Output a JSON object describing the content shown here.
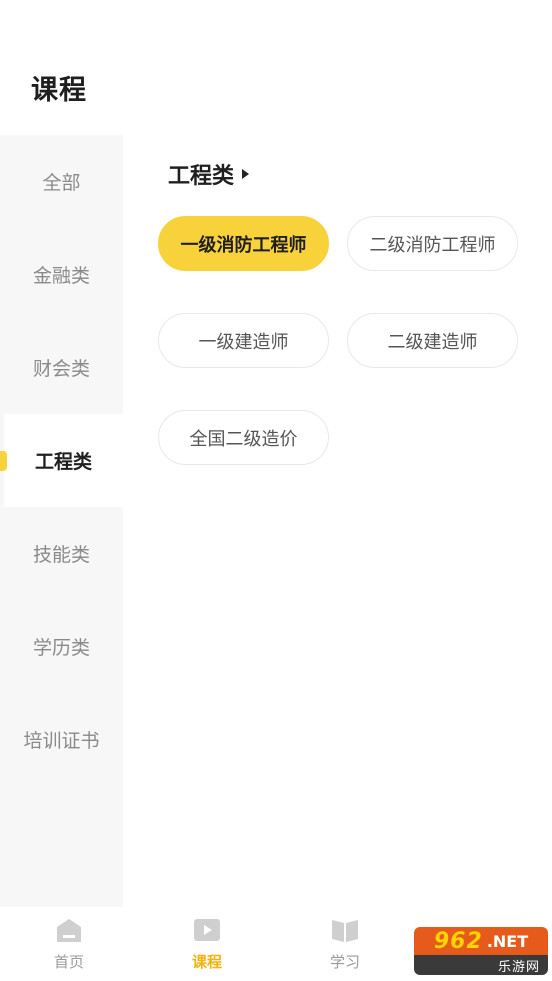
{
  "header": {
    "title": "课程"
  },
  "sidebar": {
    "items": [
      {
        "label": "全部",
        "active": false
      },
      {
        "label": "金融类",
        "active": false
      },
      {
        "label": "财会类",
        "active": false
      },
      {
        "label": "工程类",
        "active": true
      },
      {
        "label": "技能类",
        "active": false
      },
      {
        "label": "学历类",
        "active": false
      },
      {
        "label": "培训证书",
        "active": false
      }
    ]
  },
  "main": {
    "section_title": "工程类",
    "courses": [
      {
        "label": "一级消防工程师",
        "selected": true
      },
      {
        "label": "二级消防工程师",
        "selected": false
      },
      {
        "label": "一级建造师",
        "selected": false
      },
      {
        "label": "二级建造师",
        "selected": false
      },
      {
        "label": "全国二级造价",
        "selected": false
      }
    ]
  },
  "tabbar": {
    "tabs": [
      {
        "label": "首页",
        "icon": "home-icon",
        "active": false
      },
      {
        "label": "课程",
        "icon": "play-icon",
        "active": true
      },
      {
        "label": "学习",
        "icon": "book-icon",
        "active": false
      }
    ]
  },
  "watermark": {
    "digits": "962",
    "net": ".NET",
    "cn": "乐游网"
  },
  "colors": {
    "accent": "#f8d23a",
    "active_tab": "#f2b20f",
    "sidebar_bg": "#f7f7f7",
    "watermark_orange": "#e65a1b"
  }
}
